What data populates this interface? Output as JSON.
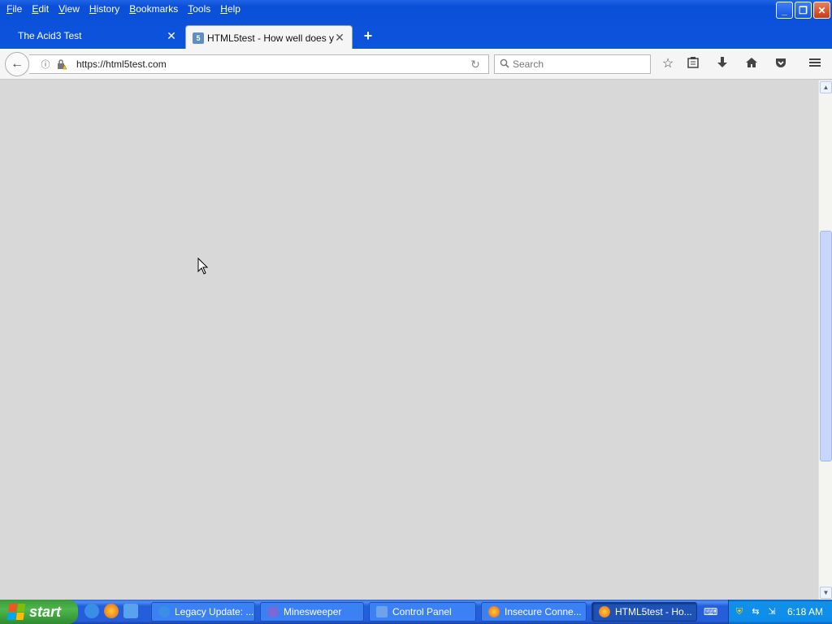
{
  "menu": {
    "items": [
      {
        "key": "F",
        "rest": "ile"
      },
      {
        "key": "E",
        "rest": "dit"
      },
      {
        "key": "V",
        "rest": "iew"
      },
      {
        "key": "H",
        "rest": "istory"
      },
      {
        "key": "B",
        "rest": "ookmarks"
      },
      {
        "key": "T",
        "rest": "ools"
      },
      {
        "key": "H",
        "rest": "elp"
      }
    ]
  },
  "tabs": [
    {
      "label": "The Acid3 Test",
      "active": false
    },
    {
      "label": "HTML5test - How well does y...",
      "active": true
    }
  ],
  "navbar": {
    "url": "https://html5test.com",
    "search_placeholder": "Search"
  },
  "taskbar": {
    "start_label": "start",
    "buttons": [
      {
        "label": "Legacy Update: ..."
      },
      {
        "label": "Minesweeper"
      },
      {
        "label": "Control Panel"
      },
      {
        "label": "Insecure Conne..."
      },
      {
        "label": "HTML5test - Ho..."
      }
    ],
    "clock": "6:18 AM"
  },
  "colors": {
    "titlebar": "#0a4fd8",
    "content_bg": "#d8d8d8",
    "start_green": "#3c9a3c",
    "taskbar_blue": "#245edb"
  }
}
